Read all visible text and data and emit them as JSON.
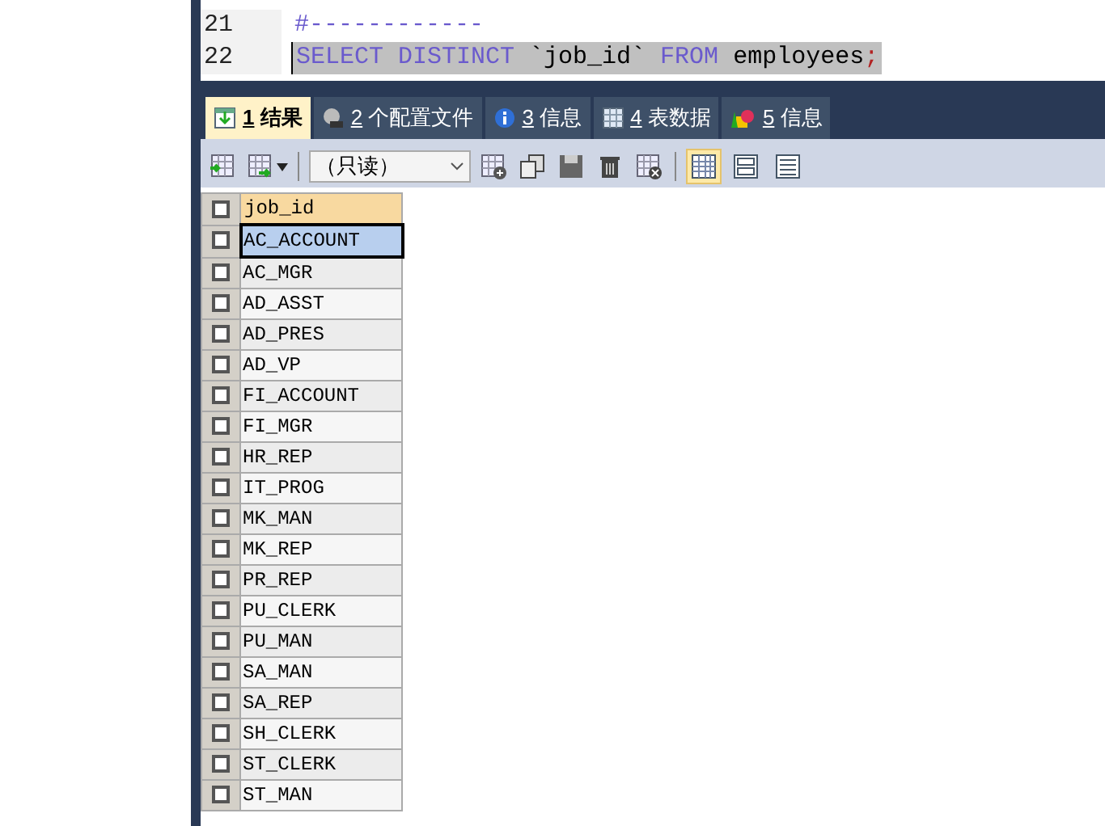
{
  "editor": {
    "lines": [
      {
        "number": "21",
        "selected": false,
        "tokens": [
          {
            "kind": "comment",
            "text": "#------------"
          }
        ]
      },
      {
        "number": "22",
        "selected": true,
        "tokens": [
          {
            "kind": "keyword",
            "text": "SELECT"
          },
          {
            "kind": "keyword",
            "text": "DISTINCT"
          },
          {
            "kind": "plain",
            "text": "`job_id`"
          },
          {
            "kind": "keyword",
            "text": "FROM"
          },
          {
            "kind": "plain",
            "text": "employees"
          },
          {
            "kind": "punct",
            "text": ";"
          }
        ]
      }
    ]
  },
  "tabs": [
    {
      "number": "1",
      "label": "结果",
      "selected": true
    },
    {
      "number": "2",
      "label": "个配置文件",
      "selected": false
    },
    {
      "number": "3",
      "label": "信息",
      "selected": false
    },
    {
      "number": "4",
      "label": "表数据",
      "selected": false
    },
    {
      "number": "5",
      "label": "信息",
      "selected": false
    }
  ],
  "toolbar": {
    "mode_select": "（只读）",
    "views": [
      {
        "kind": "grid",
        "selected": true
      },
      {
        "kind": "form",
        "selected": false
      },
      {
        "kind": "text",
        "selected": false
      }
    ]
  },
  "table": {
    "columns": [
      "job_id"
    ],
    "all_checked": false,
    "rows": [
      {
        "cells": [
          "AC_ACCOUNT"
        ],
        "selected": true,
        "checked": false
      },
      {
        "cells": [
          "AC_MGR"
        ],
        "selected": false,
        "checked": false
      },
      {
        "cells": [
          "AD_ASST"
        ],
        "selected": false,
        "checked": false
      },
      {
        "cells": [
          "AD_PRES"
        ],
        "selected": false,
        "checked": false
      },
      {
        "cells": [
          "AD_VP"
        ],
        "selected": false,
        "checked": false
      },
      {
        "cells": [
          "FI_ACCOUNT"
        ],
        "selected": false,
        "checked": false
      },
      {
        "cells": [
          "FI_MGR"
        ],
        "selected": false,
        "checked": false
      },
      {
        "cells": [
          "HR_REP"
        ],
        "selected": false,
        "checked": false
      },
      {
        "cells": [
          "IT_PROG"
        ],
        "selected": false,
        "checked": false
      },
      {
        "cells": [
          "MK_MAN"
        ],
        "selected": false,
        "checked": false
      },
      {
        "cells": [
          "MK_REP"
        ],
        "selected": false,
        "checked": false
      },
      {
        "cells": [
          "PR_REP"
        ],
        "selected": false,
        "checked": false
      },
      {
        "cells": [
          "PU_CLERK"
        ],
        "selected": false,
        "checked": false
      },
      {
        "cells": [
          "PU_MAN"
        ],
        "selected": false,
        "checked": false
      },
      {
        "cells": [
          "SA_MAN"
        ],
        "selected": false,
        "checked": false
      },
      {
        "cells": [
          "SA_REP"
        ],
        "selected": false,
        "checked": false
      },
      {
        "cells": [
          "SH_CLERK"
        ],
        "selected": false,
        "checked": false
      },
      {
        "cells": [
          "ST_CLERK"
        ],
        "selected": false,
        "checked": false
      },
      {
        "cells": [
          "ST_MAN"
        ],
        "selected": false,
        "checked": false
      }
    ]
  }
}
